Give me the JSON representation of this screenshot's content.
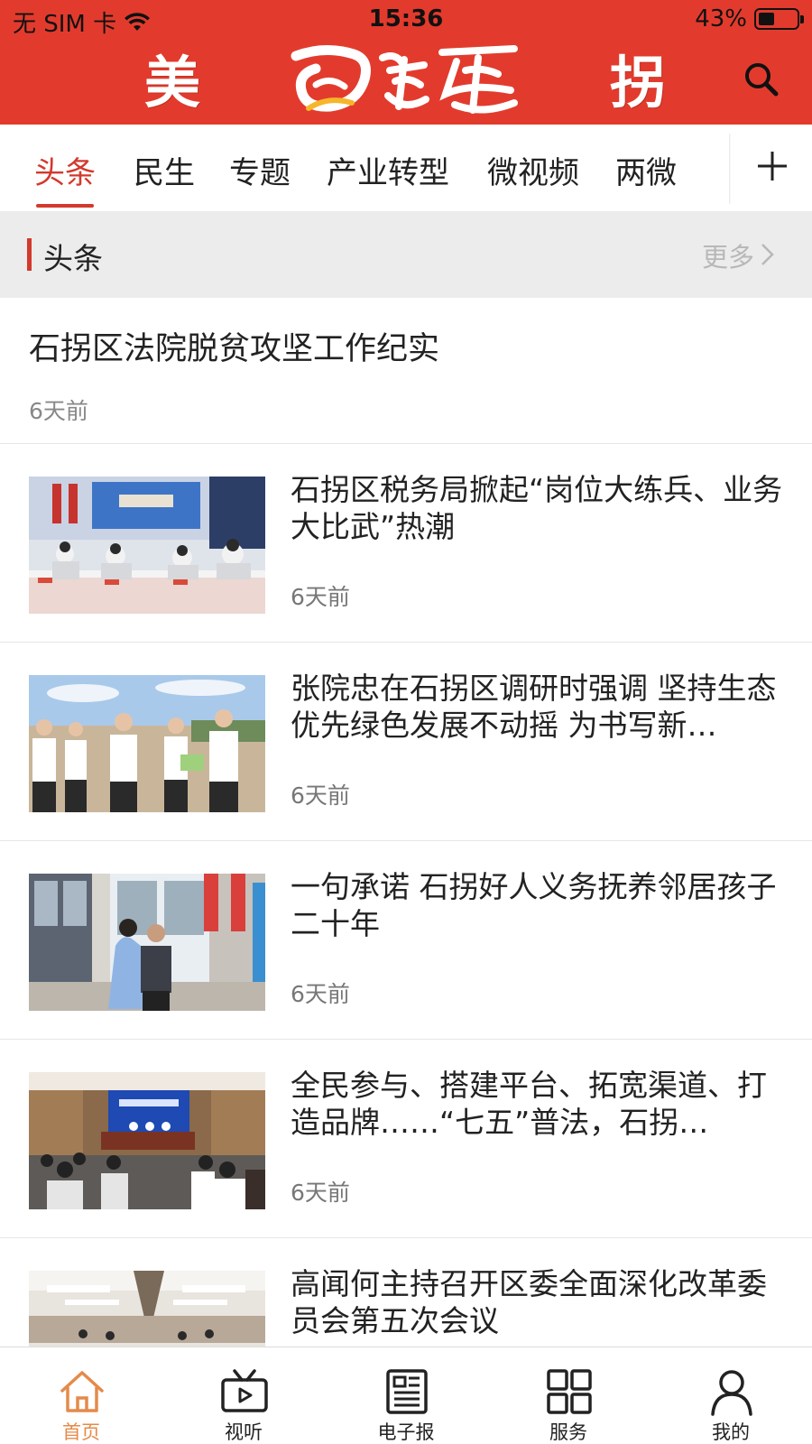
{
  "status_bar": {
    "carrier": "无 SIM 卡",
    "time": "15:36",
    "battery": "43%",
    "battery_level": 0.43
  },
  "header": {
    "logo_left": "美",
    "logo_right": "拐",
    "search_icon": "search-icon",
    "brand_color": "#e23b2d"
  },
  "tabs": [
    {
      "label": "头条",
      "active": true
    },
    {
      "label": "民生",
      "active": false
    },
    {
      "label": "专题",
      "active": false
    },
    {
      "label": "产业转型",
      "active": false
    },
    {
      "label": "微视频",
      "active": false
    },
    {
      "label": "两微",
      "active": false
    }
  ],
  "tabs_add_icon": "plus-icon",
  "accent_color": "#d23a2c",
  "section": {
    "title": "头条",
    "more": "更多"
  },
  "lead_article": {
    "title": "石拐区法院脱贫攻坚工作纪实",
    "time": "6天前"
  },
  "articles": [
    {
      "title": "石拐区税务局掀起“岗位大练兵、业务大比武”热潮",
      "time": "6天前"
    },
    {
      "title": "张院忠在石拐区调研时强调 坚持生态优先绿色发展不动摇 为书写新…",
      "time": "6天前"
    },
    {
      "title": "一句承诺 石拐好人义务抚养邻居孩子二十年",
      "time": "6天前"
    },
    {
      "title": "全民参与、搭建平台、拓宽渠道、打造品牌……“七五”普法，石拐…",
      "time": "6天前"
    },
    {
      "title": "高闻何主持召开区委全面深化改革委员会第五次会议",
      "time": ""
    }
  ],
  "bottom_nav": [
    {
      "label": "首页",
      "icon": "home-icon",
      "active": true
    },
    {
      "label": "视听",
      "icon": "video-icon",
      "active": false
    },
    {
      "label": "电子报",
      "icon": "newspaper-icon",
      "active": false
    },
    {
      "label": "服务",
      "icon": "grid-icon",
      "active": false
    },
    {
      "label": "我的",
      "icon": "user-icon",
      "active": false
    }
  ],
  "nav_active_color": "#e58a4a"
}
